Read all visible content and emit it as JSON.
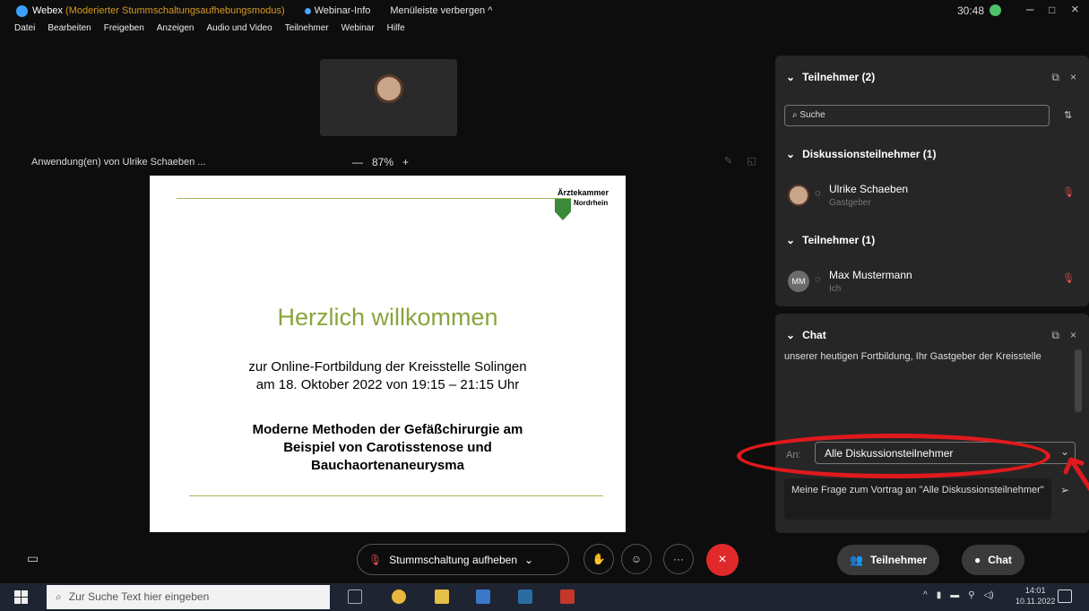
{
  "window": {
    "app_name": "Webex",
    "mode": "(Moderierter Stummschaltungsaufhebungsmodus)",
    "webinar_info": "Webinar-Info",
    "hide_menu": "Menüleiste verbergen ^",
    "timer": "30:48",
    "minimize": "–",
    "maximize": "□",
    "close": "×"
  },
  "menu": [
    "Datei",
    "Bearbeiten",
    "Freigeben",
    "Anzeigen",
    "Audio und Video",
    "Teilnehmer",
    "Webinar",
    "Hilfe"
  ],
  "share": {
    "label": "Anwendung(en) von Ulrike Schaeben ...",
    "zoom_out": "—",
    "zoom_level": "87%",
    "zoom_in": "+"
  },
  "slide": {
    "logo_line1": "Ärztekammer",
    "logo_line2": "Nordrhein",
    "title": "Herzlich willkommen",
    "subtitle_line1": "zur Online-Fortbildung der Kreisstelle Solingen",
    "subtitle_line2": "am 18. Oktober 2022 von 19:15 – 21:15 Uhr",
    "topic_line1": "Moderne Methoden der Gefäßchirurgie am",
    "topic_line2": "Beispiel von Carotisstenose und",
    "topic_line3": "Bauchaortenaneurysma"
  },
  "participants_panel": {
    "header": "Teilnehmer (2)",
    "search_placeholder": "Suche",
    "section_panelists": "Diskussionsteilnehmer (1)",
    "section_attendees": "Teilnehmer (1)",
    "people": [
      {
        "name": "Ulrike Schaeben",
        "role": "Gastgeber",
        "initials": ""
      },
      {
        "name": "Max Mustermann",
        "role": "Ich",
        "initials": "MM"
      }
    ]
  },
  "chat_panel": {
    "header": "Chat",
    "message": "unserer heutigen Fortbildung, Ihr Gastgeber der Kreisstelle",
    "to_label": "An:",
    "recipient": "Alle Diskussionsteilnehmer",
    "input_placeholder": "Meine Frage zum Vortrag an \"Alle Diskussionsteilnehmer\""
  },
  "toolbar": {
    "unmute": "Stummschaltung aufheben",
    "participants": "Teilnehmer",
    "chat": "Chat",
    "more": "···",
    "leave": "×"
  },
  "taskbar": {
    "search_placeholder": "Zur Suche Text hier eingeben",
    "time": "14:01",
    "date": "10.11.2022"
  }
}
